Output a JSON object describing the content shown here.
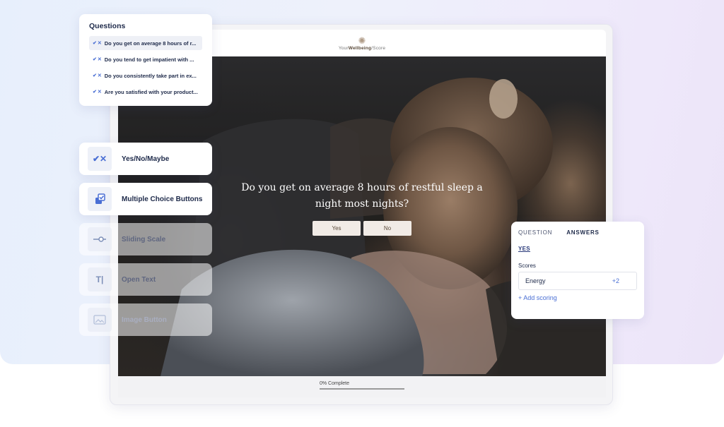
{
  "quiz": {
    "brand": {
      "prefix": "Your",
      "highlight": "Wellbeing",
      "suffix": "/Score",
      "icon": "sun-icon"
    },
    "question_line1": "Do you get on average 8 hours of restful sleep a",
    "question_line2": "night most nights?",
    "answers": [
      "Yes",
      "No"
    ],
    "progress_text": "0% Complete",
    "progress_fraction": 0
  },
  "questions_panel": {
    "title": "Questions",
    "items": [
      "Do you get on average 8 hours of r...",
      "Do you tend to get impatient with ...",
      "Do you consistently take part in ex...",
      "Are you satisfied with your product..."
    ]
  },
  "question_types": [
    {
      "label": "Yes/No/Maybe",
      "icon": "check-x-icon"
    },
    {
      "label": "Multiple Choice Buttons",
      "icon": "multiple-choice-icon"
    },
    {
      "label": "Sliding Scale",
      "icon": "slider-icon"
    },
    {
      "label": "Open Text",
      "icon": "text-cursor-icon"
    },
    {
      "label": "Image Button",
      "icon": "image-icon"
    }
  ],
  "answer_panel": {
    "tab_question": "QUESTION",
    "tab_answers": "ANSWERS",
    "selected_answer": "YES",
    "scores_label": "Scores",
    "score_name": "Energy",
    "score_value": "+2",
    "add_scoring": "+ Add scoring"
  },
  "colors": {
    "accent": "#4a6fd4",
    "navy": "#1e2a4a",
    "answer_button_bg": "#f1ebe6"
  }
}
